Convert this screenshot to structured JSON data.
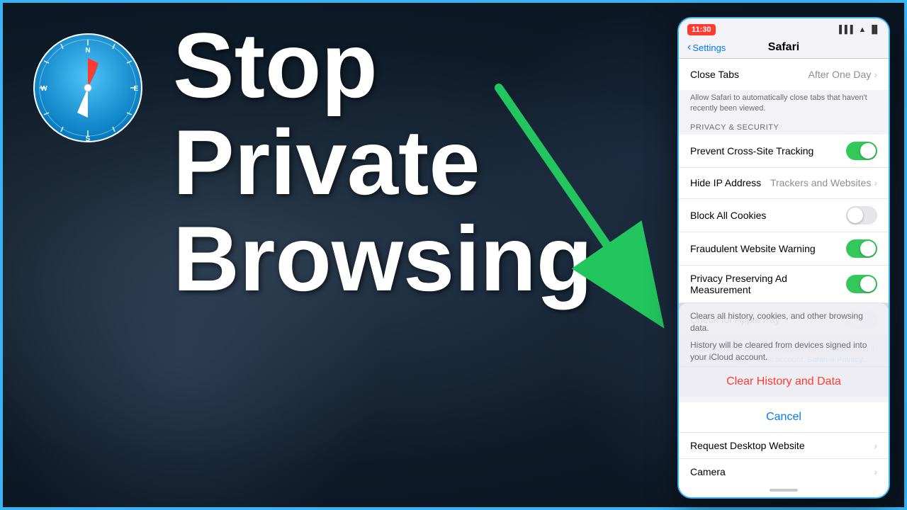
{
  "border_color": "#3ab4f2",
  "background": {
    "description": "dark bokeh background"
  },
  "overlay_text": {
    "line1": "Stop",
    "line2": "Private",
    "line3": "Browsing"
  },
  "status_bar": {
    "time": "11:30",
    "icons": "●●● ▲ 🔋"
  },
  "nav": {
    "back_label": "Settings",
    "title": "Safari"
  },
  "close_tabs": {
    "label": "Close Tabs",
    "value": "After One Day",
    "description": "Allow Safari to automatically close tabs that haven't recently been viewed."
  },
  "privacy_section": {
    "label": "PRIVACY & SECURITY",
    "items": [
      {
        "label": "Prevent Cross-Site Tracking",
        "toggle": "on"
      },
      {
        "label": "Hide IP Address",
        "value": "Trackers and Websites",
        "has_chevron": true
      },
      {
        "label": "Block All Cookies",
        "toggle": "off"
      },
      {
        "label": "Fraudulent Website Warning",
        "toggle": "on"
      },
      {
        "label": "Privacy Preserving Ad Measurement",
        "toggle": "on"
      },
      {
        "label": "Check for Apple Pay",
        "toggle": "off"
      }
    ]
  },
  "apple_pay_desc": "Allow websites to check if Apple Pay is enabled and if you have an Apple Card account.",
  "apple_pay_link": "Safari & Privacy...",
  "modal": {
    "desc1": "Clears all history, cookies, and other browsing data.",
    "desc2": "History will be cleared from devices signed into your iCloud account.",
    "clear_button": "Clear History and Data",
    "cancel_button": "Cancel"
  },
  "below_modal": {
    "label": "Request Desktop Website"
  },
  "bottom_row": {
    "label": "Camera"
  }
}
